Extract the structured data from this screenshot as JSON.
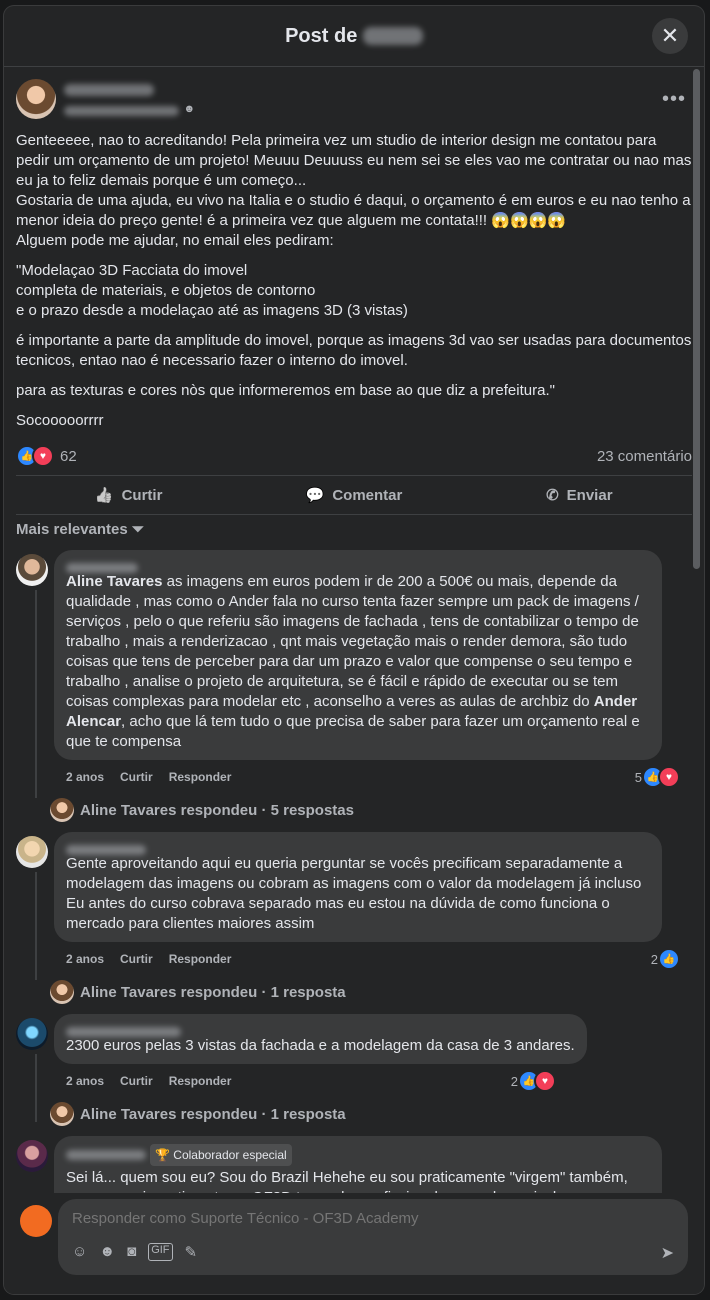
{
  "modal": {
    "title_prefix": "Post de",
    "close_glyph": "✕"
  },
  "post": {
    "more_glyph": "•••",
    "privacy_glyph": "☻",
    "paragraphs": [
      "Genteeeee, nao to acreditando! Pela primeira vez um studio de interior design me contatou para pedir um orçamento de um projeto! Meuuu Deuuuss eu nem sei se eles vao me contratar ou nao mas eu ja to feliz demais porque é um começo...\nGostaria de uma ajuda, eu vivo na Italia e o studio é daqui, o orçamento é em euros e eu nao tenho a menor ideia do preço gente! é a primeira vez que alguem me contata!!! 😱😱😱😱\nAlguem pode me ajudar, no email eles pediram:",
      "\"Modelaçao 3D Facciata do imovel\ncompleta de materiais, e objetos de contorno\ne o prazo desde a modelaçao até as imagens 3D (3 vistas)",
      "é importante a parte da amplitude do imovel, porque as imagens 3d vao ser usadas para documentos tecnicos, entao nao é necessario fazer o interno do imovel.",
      "para as texturas e cores nòs que informeremos em base ao que diz a prefeitura.\"",
      "Socooooorrrr"
    ],
    "reaction_count": "62",
    "comment_count": "23 comentário"
  },
  "actions": {
    "like": "Curtir",
    "like_icon": "👍",
    "comment": "Comentar",
    "comment_icon": "💬",
    "send": "Enviar",
    "send_icon": "✆"
  },
  "sort_label": "Mais relevantes ⏷",
  "comments": [
    {
      "mention1": "Aline Tavares",
      "text1": " as imagens em euros podem ir de 200 a 500€ ou mais, depende da qualidade , mas como o Ander fala no curso tenta fazer sempre um pack de imagens / serviços , pelo o que referiu são imagens de fachada , tens de contabilizar o tempo de trabalho , mais a renderizacao , qnt mais vegetação mais o render demora, são tudo coisas que tens de perceber para dar um prazo e valor que compense o seu tempo e trabalho , analise o projeto de arquitetura, se é fácil e rápido de executar ou se tem coisas complexas para modelar etc , aconselho a veres as aulas de archbiz do ",
      "mention2": "Ander Alencar",
      "text2": ", acho que lá tem tudo o que precisa de saber para fazer um orçamento real e que te compensa",
      "time": "2 anos",
      "like": "Curtir",
      "reply": "Responder",
      "react_count": "5",
      "replies": "Aline Tavares respondeu · 5 respostas"
    },
    {
      "text": "Gente aproveitando aqui eu queria perguntar se vocês precificam separadamente a modelagem das imagens ou cobram as imagens com o valor da modelagem já incluso\nEu antes do curso cobrava separado mas eu estou na dúvida de como funciona o mercado para clientes maiores assim",
      "time": "2 anos",
      "like": "Curtir",
      "reply": "Responder",
      "react_count": "2",
      "replies": "Aline Tavares respondeu · 1 resposta"
    },
    {
      "text": "2300 euros pelas 3 vistas da fachada e a modelagem da casa de 3 andares.",
      "time": "2 anos",
      "like": "Curtir",
      "reply": "Responder",
      "react_count": "2",
      "replies": "Aline Tavares respondeu · 1 resposta"
    },
    {
      "badge": "🏆 Colaborador especial",
      "text": "Sei lá... quem sou eu? Sou do Brazil Hehehe eu sou praticamente \"virgem\" também, mas nosso investimento no OF3D tem valor profissional que pode ser incluso.\nSeria uma fachada? Vai fazer a modelagem do zero? Ou texturizar e fazer o render?\nIsso conta, boto fé, em todo o tempo e serviço."
    }
  ],
  "composer": {
    "placeholder": "Responder como Suporte Técnico - OF3D Academy",
    "icons": [
      "☺",
      "☻",
      "◙",
      "GIF",
      "✎"
    ],
    "send_glyph": "➤"
  },
  "colors": {
    "like": "#2d88ff",
    "love": "#f33e58",
    "accent": "#f26b21"
  }
}
